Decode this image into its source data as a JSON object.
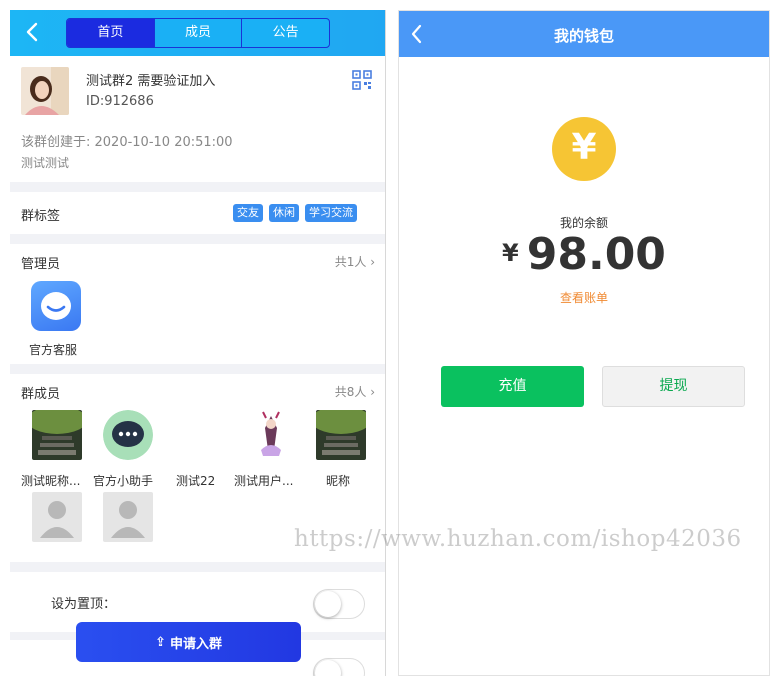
{
  "group_screen": {
    "tabs": [
      {
        "label": "首页",
        "active": true
      },
      {
        "label": "成员",
        "active": false
      },
      {
        "label": "公告",
        "active": false
      }
    ],
    "group": {
      "name": "测试群2 需要验证加入",
      "id": "ID:912686",
      "created": "该群创建于: 2020-10-10 20:51:00",
      "description": "测试测试"
    },
    "tags_section": {
      "label": "群标签",
      "tags": [
        "交友",
        "休闲",
        "学习交流"
      ]
    },
    "admins_section": {
      "label": "管理员",
      "count": "共1人",
      "admins": [
        {
          "name": "官方客服"
        }
      ]
    },
    "members_section": {
      "label": "群成员",
      "count": "共8人",
      "members": [
        {
          "name": "测试昵称..."
        },
        {
          "name": "官方小助手"
        },
        {
          "name": "测试22"
        },
        {
          "name": "测试用户..."
        },
        {
          "name": "昵称"
        },
        {
          "name": ""
        },
        {
          "name": ""
        }
      ]
    },
    "pin_row": {
      "label": "设为置顶："
    },
    "apply_button": "申请入群"
  },
  "wallet_screen": {
    "title": "我的钱包",
    "currency_symbol": "¥",
    "balance_label": "我的余额",
    "balance": "98.00",
    "bill_link": "查看账单",
    "recharge_button": "充值",
    "withdraw_button": "提现"
  },
  "watermark": "https://www.huzhan.com/ishop42036",
  "colors": {
    "header_blue": "#1db6f5",
    "active_tab": "#1b2be0",
    "wallet_header": "#4a98f7",
    "tag_blue": "#3a8ef0",
    "recharge_green": "#0ac15f",
    "coin_yellow": "#f6c534",
    "bill_orange": "#f08b34"
  }
}
